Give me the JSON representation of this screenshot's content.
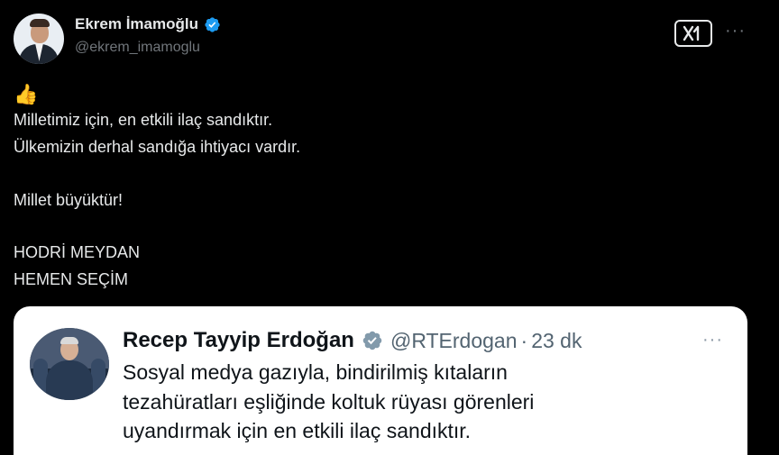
{
  "author": {
    "display_name": "Ekrem İmamoğlu",
    "handle": "@ekrem_imamoglu",
    "verified_color": "#1d9bf0"
  },
  "tweet": {
    "emoji": "👍",
    "lines": [
      "Milletimiz için, en etkili ilaç sandıktır.",
      "Ülkemizin derhal sandığa ihtiyacı vardır.",
      "",
      "Millet büyüktür!",
      "",
      "HODRİ MEYDAN",
      "HEMEN SEÇİM"
    ]
  },
  "actions": {
    "grok_icon": "grok-icon",
    "more_icon": "more-icon",
    "more_label": "···"
  },
  "quoted": {
    "display_name": "Recep Tayyip Erdoğan",
    "handle": "@RTErdogan",
    "separator": "·",
    "time": "23 dk",
    "more_label": "···",
    "badge_color": "#829aab",
    "lines": [
      "Sosyal medya gazıyla, bindirilmiş kıtaların",
      "tezahüratları eşliğinde koltuk rüyası görenleri",
      "uyandırmak için en etkili ilaç sandıktır."
    ]
  }
}
